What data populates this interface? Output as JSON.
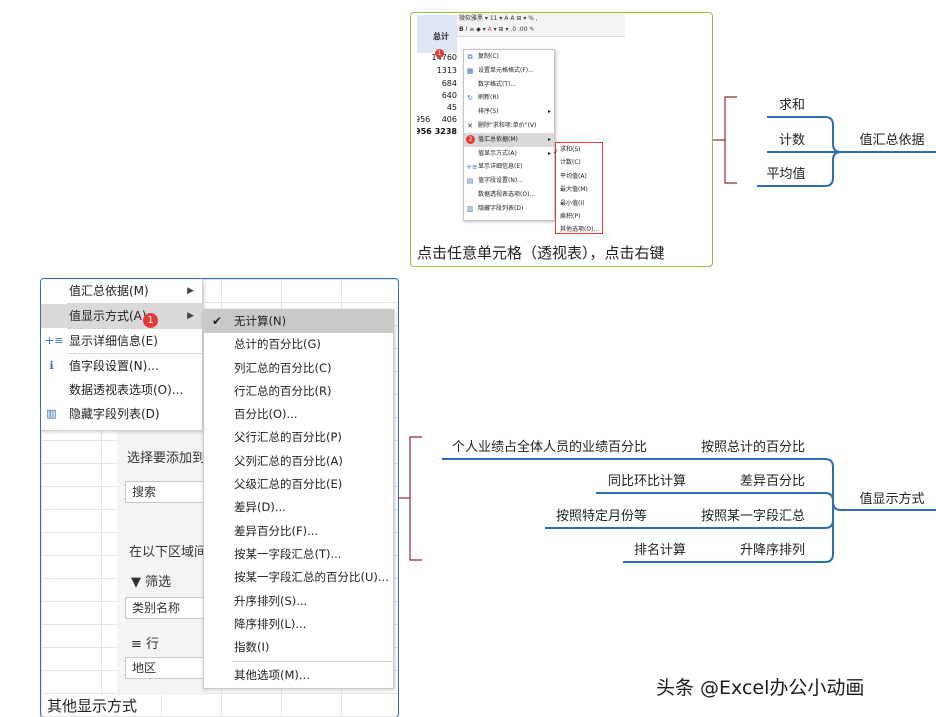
{
  "top_card": {
    "ribbon_font": "微软雅黑",
    "ribbon_size": "11",
    "column_header": "总计",
    "cells": [
      "14760",
      "1313",
      "684",
      "640",
      "45",
      "406",
      "3238"
    ],
    "left_cells": [
      "956",
      "956"
    ],
    "menu_items": [
      {
        "label": "复制(C)",
        "icon": "copy-icon"
      },
      {
        "label": "设置单元格格式(F)...",
        "icon": "format-cells-icon"
      },
      {
        "label": "数字格式(T)...",
        "icon": ""
      },
      {
        "label": "刷新(R)",
        "icon": "refresh-icon"
      },
      {
        "label": "排序(S)",
        "icon": "",
        "submenu": true
      },
      {
        "label": "删除\"求和项:单价\"(V)",
        "icon": "delete-icon"
      },
      {
        "label": "值汇总依据(M)",
        "icon": "",
        "submenu": true,
        "highlighted": true
      },
      {
        "label": "值显示方式(A)",
        "icon": "",
        "submenu": true
      },
      {
        "label": "显示详细信息(E)",
        "icon": "detail-icon"
      },
      {
        "label": "值字段设置(N)...",
        "icon": "field-settings-icon"
      },
      {
        "label": "数据透视表选项(O)...",
        "icon": ""
      },
      {
        "label": "隐藏字段列表(D)",
        "icon": "field-list-icon"
      }
    ],
    "submenu_items": [
      "求和(S)",
      "计数(C)",
      "平均值(A)",
      "最大值(M)",
      "最小值(I)",
      "乘积(P)",
      "其他选项(O)..."
    ],
    "badge_1": "1",
    "badge_2": "2",
    "caption": "点击任意单元格（透视表），点击右键"
  },
  "bottom_card": {
    "menu_items": [
      {
        "label": "值汇总依据(M)",
        "submenu": true
      },
      {
        "label": "值显示方式(A)",
        "submenu": true,
        "highlighted": true
      },
      {
        "label": "显示详细信息(E)",
        "icon": "detail-icon"
      },
      {
        "label": "值字段设置(N)...",
        "icon": "info-icon"
      },
      {
        "label": "数据透视表选项(O)..."
      },
      {
        "label": "隐藏字段列表(D)",
        "icon": "field-list-icon"
      }
    ],
    "badge": "1",
    "submenu_items": [
      "无计算(N)",
      "总计的百分比(G)",
      "列汇总的百分比(C)",
      "行汇总的百分比(R)",
      "百分比(O)...",
      "父行汇总的百分比(P)",
      "父列汇总的百分比(A)",
      "父级汇总的百分比(E)",
      "差异(D)...",
      "差异百分比(F)...",
      "按某一字段汇总(T)...",
      "按某一字段汇总的百分比(U)...",
      "升序排列(S)...",
      "降序排列(L)...",
      "指数(I)",
      "其他选项(M)..."
    ],
    "panel": {
      "choose_fields": "选择要添加到报",
      "search_placeholder": "搜索",
      "drag_fields": "在以下区域间拖",
      "filter_label": "筛选",
      "filter_field": "类别名称",
      "row_label": "行",
      "row_field": "地区"
    },
    "caption": "其他显示方式"
  },
  "mindmap_top": {
    "root": "值汇总依据",
    "branches": [
      "求和",
      "计数",
      "平均值"
    ]
  },
  "mindmap_bottom": {
    "root": "值显示方式",
    "pairs": [
      {
        "left": "个人业绩占全体人员的业绩百分比",
        "right": "按照总计的百分比"
      },
      {
        "left": "同比环比计算",
        "right": "差异百分比"
      },
      {
        "left": "按照特定月份等",
        "right": "按照某一字段汇总"
      },
      {
        "left": "排名计算",
        "right": "升降序排列"
      }
    ]
  },
  "watermark": "头条 @Excel办公小动画",
  "colors": {
    "line_blue": "#2e6db4",
    "bracket_red": "#8b2f2f",
    "badge_red": "#e53935",
    "card_green": "#8bc34a"
  }
}
